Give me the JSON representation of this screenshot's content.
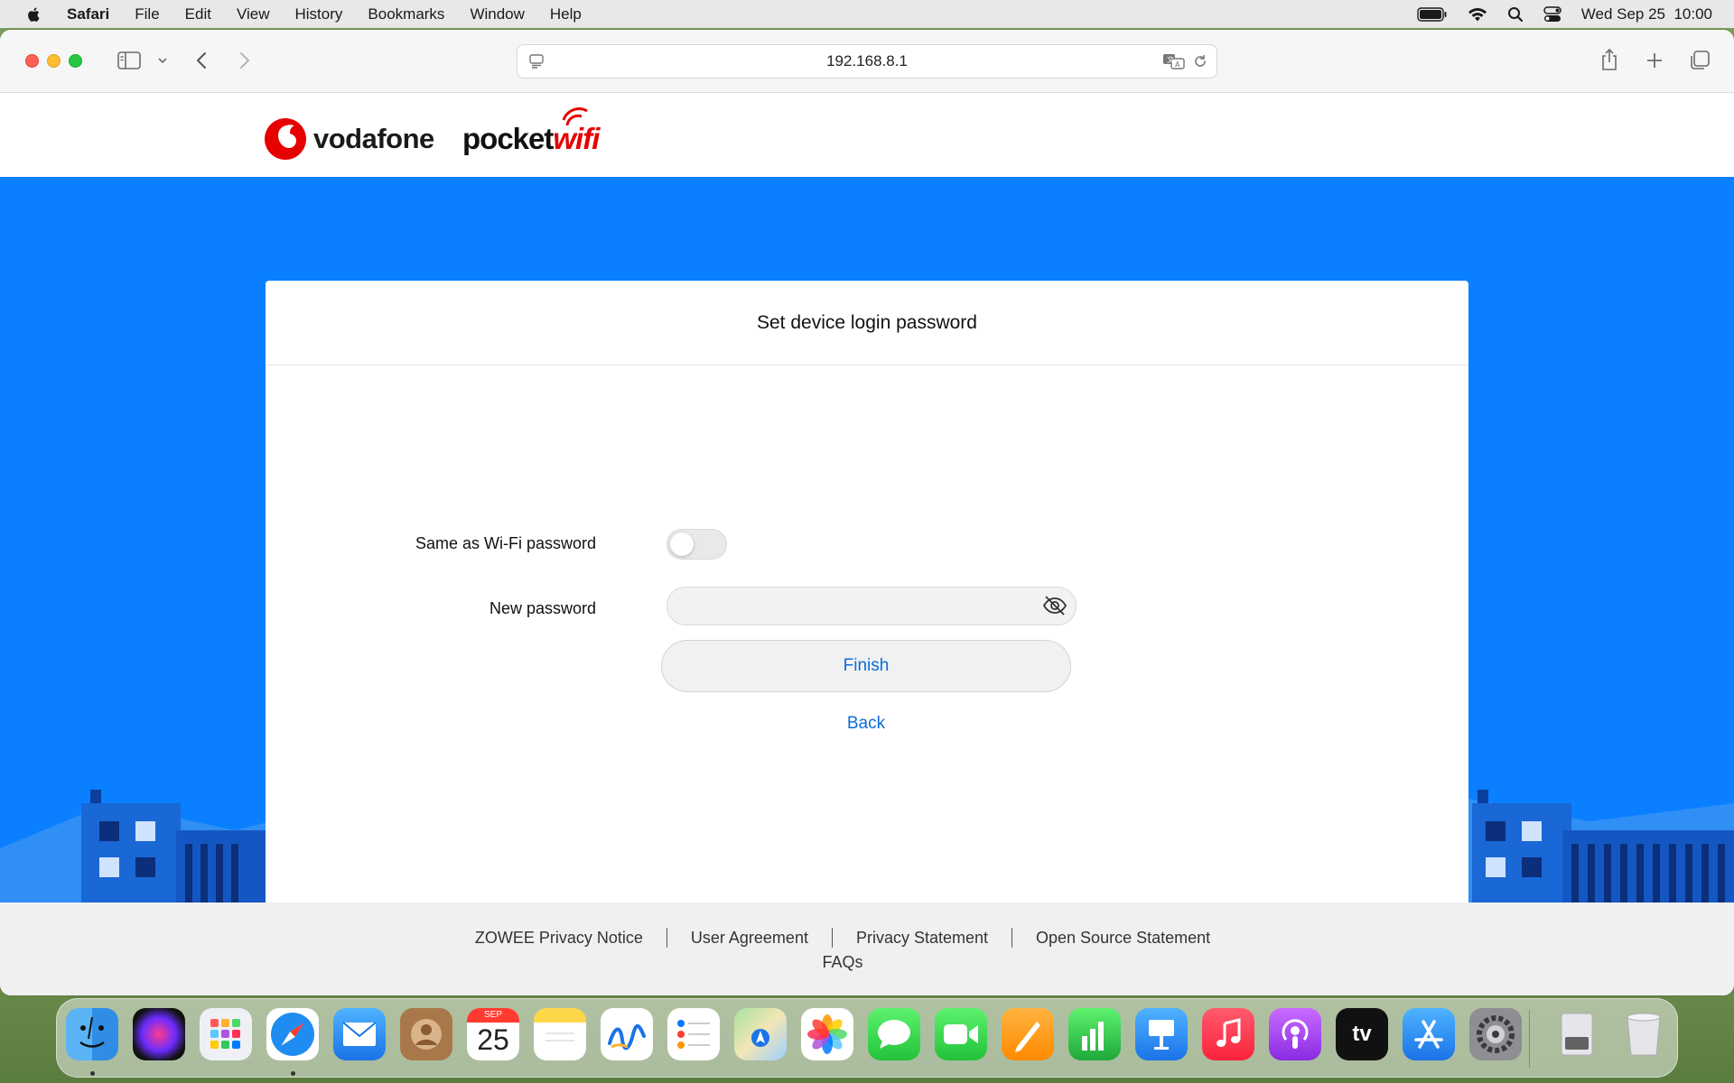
{
  "menubar": {
    "app_name": "Safari",
    "items": [
      "File",
      "Edit",
      "View",
      "History",
      "Bookmarks",
      "Window",
      "Help"
    ],
    "datetime": "Wed Sep 25  10:00"
  },
  "browser": {
    "url": "192.168.8.1"
  },
  "brand": {
    "vodafone": "vodafone",
    "pocketwifi_prefix": "pocket",
    "pocketwifi_suffix": "wifi",
    "vodafone_red": "#e60000",
    "page_blue": "#0a7fff"
  },
  "card": {
    "title": "Set device login password",
    "same_as_wifi_label": "Same as Wi-Fi password",
    "same_as_wifi_on": false,
    "new_password_label": "New password",
    "new_password_value": "",
    "finish_label": "Finish",
    "back_label": "Back"
  },
  "footer": {
    "links": [
      "ZOWEE Privacy Notice",
      "User Agreement",
      "Privacy Statement",
      "Open Source Statement"
    ],
    "faq": "FAQs"
  },
  "dock": {
    "calendar_month": "SEP",
    "calendar_day": "25",
    "tv_label": "tv",
    "apps": [
      "finder-icon",
      "siri-icon",
      "launchpad-icon",
      "safari-icon",
      "mail-icon",
      "contacts-icon",
      "calendar-icon",
      "notes-icon",
      "freeform-icon",
      "reminders-icon",
      "maps-icon",
      "photos-icon",
      "messages-icon",
      "facetime-icon",
      "pages-icon",
      "numbers-icon",
      "keynote-icon",
      "music-icon",
      "podcasts-icon",
      "apple-tv-icon",
      "app-store-icon",
      "system-settings-icon",
      "disk-utility-icon",
      "trash-icon"
    ]
  }
}
